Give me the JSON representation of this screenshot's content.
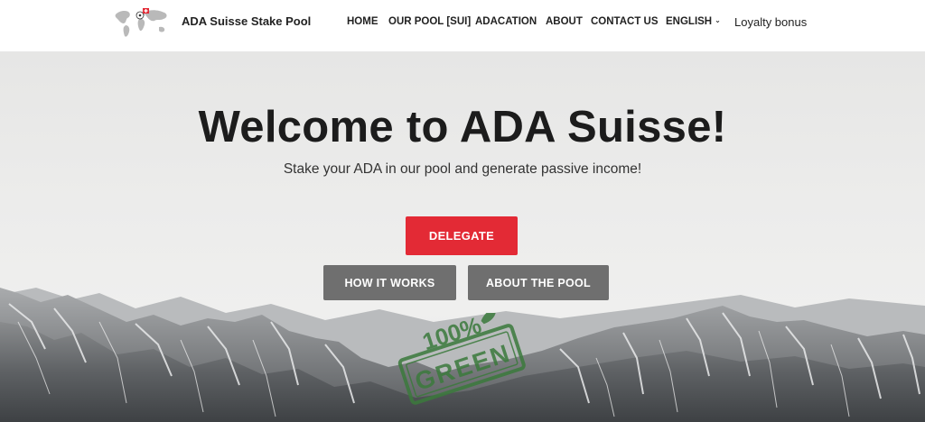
{
  "header": {
    "brand": "ADA Suisse Stake Pool",
    "nav": [
      {
        "label": "HOME"
      },
      {
        "label": "OUR POOL [SUI]"
      },
      {
        "label": "ADACATION"
      },
      {
        "label": "ABOUT"
      },
      {
        "label": "CONTACT US"
      },
      {
        "label": "ENGLISH",
        "has_dropdown": true
      },
      {
        "label": "Loyalty bonus"
      }
    ]
  },
  "hero": {
    "title": "Welcome to ADA Suisse!",
    "subtitle": "Stake your ADA in our pool and generate passive income!",
    "buttons": {
      "delegate": "DELEGATE",
      "how_it_works": "HOW IT WORKS",
      "about_pool": "ABOUT THE POOL"
    },
    "stamp_text": "100% GREEN"
  },
  "colors": {
    "accent": "#e32a35",
    "secondary_button": "#6f6f6f",
    "stamp": "#3b7a3c"
  }
}
